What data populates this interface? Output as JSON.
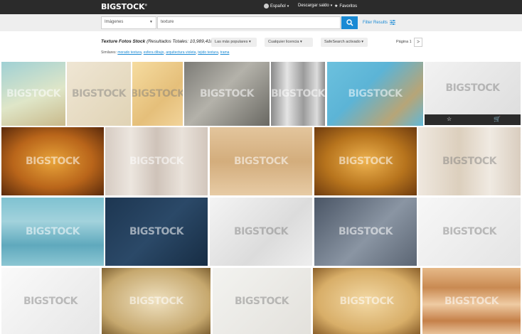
{
  "header": {
    "logo": "BIGSTOCK",
    "logo_mark": "®",
    "language": "Español",
    "downloads": "Descargar saldo",
    "favorites": "Favoritos"
  },
  "search": {
    "type_selected": "Imágenes",
    "query": "texture",
    "filter_label": "Filter Results"
  },
  "results": {
    "title": "Texture Fotos Stock",
    "count_text": "(Resultados Totales: 10,989,418)",
    "similar_label": "Similares:",
    "similar": [
      "morado textura",
      "esfera dibujo",
      "arquitectura violeta",
      "tejido textura",
      "trama"
    ],
    "sort": "Las más populares",
    "license": "Cualquier licencia",
    "safesearch": "SafeSearch activado",
    "page_label": "Página 1",
    "next_label": ">"
  },
  "watermark": "BIGSTOCK",
  "tiles": [
    {
      "name": "texture-tile-1",
      "bg": "linear-gradient(160deg,#9fd0d4,#dfe6c8 55%,#c9b98a)"
    },
    {
      "name": "texture-tile-2",
      "bg": "linear-gradient(135deg,#efe6d4,#e0d3b5)"
    },
    {
      "name": "texture-tile-3",
      "bg": "linear-gradient(135deg,#f6dca0,#e5bf7a 60%,#f2d49a)"
    },
    {
      "name": "texture-tile-4",
      "bg": "linear-gradient(135deg,#7c7b76,#b4b2aa 45%,#696862)"
    },
    {
      "name": "texture-tile-5",
      "bg": "linear-gradient(90deg,#8a8a8a,#e4e4e4 30%,#9b9b9b 60%,#dcdcdc 85%,#8d8d8d)"
    },
    {
      "name": "texture-tile-6",
      "bg": "linear-gradient(135deg,#6cc1de,#5cb4d6 40%,#b7a577 75%,#61b8d8)"
    },
    {
      "name": "texture-tile-7",
      "bg": "linear-gradient(135deg,#f2f2f2,#dedede)"
    },
    {
      "name": "texture-tile-8",
      "bg": "radial-gradient(ellipse at center,#e8a43a,#b9651a 55%,#5a2a0c)"
    },
    {
      "name": "texture-tile-9",
      "bg": "linear-gradient(90deg,#d6cbc2,#ece6df 25%,#cfc3b9 50%,#e9e2da 75%,#d2c6bc)"
    },
    {
      "name": "texture-tile-10",
      "bg": "linear-gradient(180deg,#e3c59c,#d3ad7c 50%,#e7cba5)"
    },
    {
      "name": "texture-tile-11",
      "bg": "radial-gradient(ellipse at center,#eeb350,#b7741d 55%,#6e3b0f)"
    },
    {
      "name": "texture-tile-12",
      "bg": "linear-gradient(90deg,#efe8df,#dccfbd 40%,#f0eae2 70%,#d9cdbf)"
    },
    {
      "name": "texture-tile-13",
      "bg": "linear-gradient(180deg,#7fc2d1,#a2d2dc 35%,#5fa9bd 70%,#8cc6d3)"
    },
    {
      "name": "texture-tile-14",
      "bg": "linear-gradient(135deg,#1d3651,#2b4968 50%,#172d44)"
    },
    {
      "name": "texture-tile-15",
      "bg": "linear-gradient(135deg,#f4f4f4,#dcdcdc 60%,#eeeeee)"
    },
    {
      "name": "texture-tile-16",
      "bg": "linear-gradient(135deg,#4a5565,#8a95a3 55%,#5b6573)"
    },
    {
      "name": "texture-tile-17",
      "bg": "linear-gradient(135deg,#f7f7f7,#e4e4e4)"
    },
    {
      "name": "texture-tile-18",
      "bg": "linear-gradient(135deg,#fafafa,#e6e6e6)"
    },
    {
      "name": "texture-tile-19",
      "bg": "radial-gradient(ellipse at center,#efe1c0,#c6a86e 70%,#7f6233)"
    },
    {
      "name": "texture-tile-20",
      "bg": "linear-gradient(135deg,#f3f3f0,#e3e1dc)"
    },
    {
      "name": "texture-tile-21",
      "bg": "radial-gradient(ellipse at center,#f3d9a5,#d8ae68 65%,#8a5f2a)"
    },
    {
      "name": "texture-tile-22",
      "bg": "linear-gradient(180deg,#e6b988,#c98a52 30%,#efcba3 55%,#c58049 80%,#e8c198)"
    }
  ]
}
